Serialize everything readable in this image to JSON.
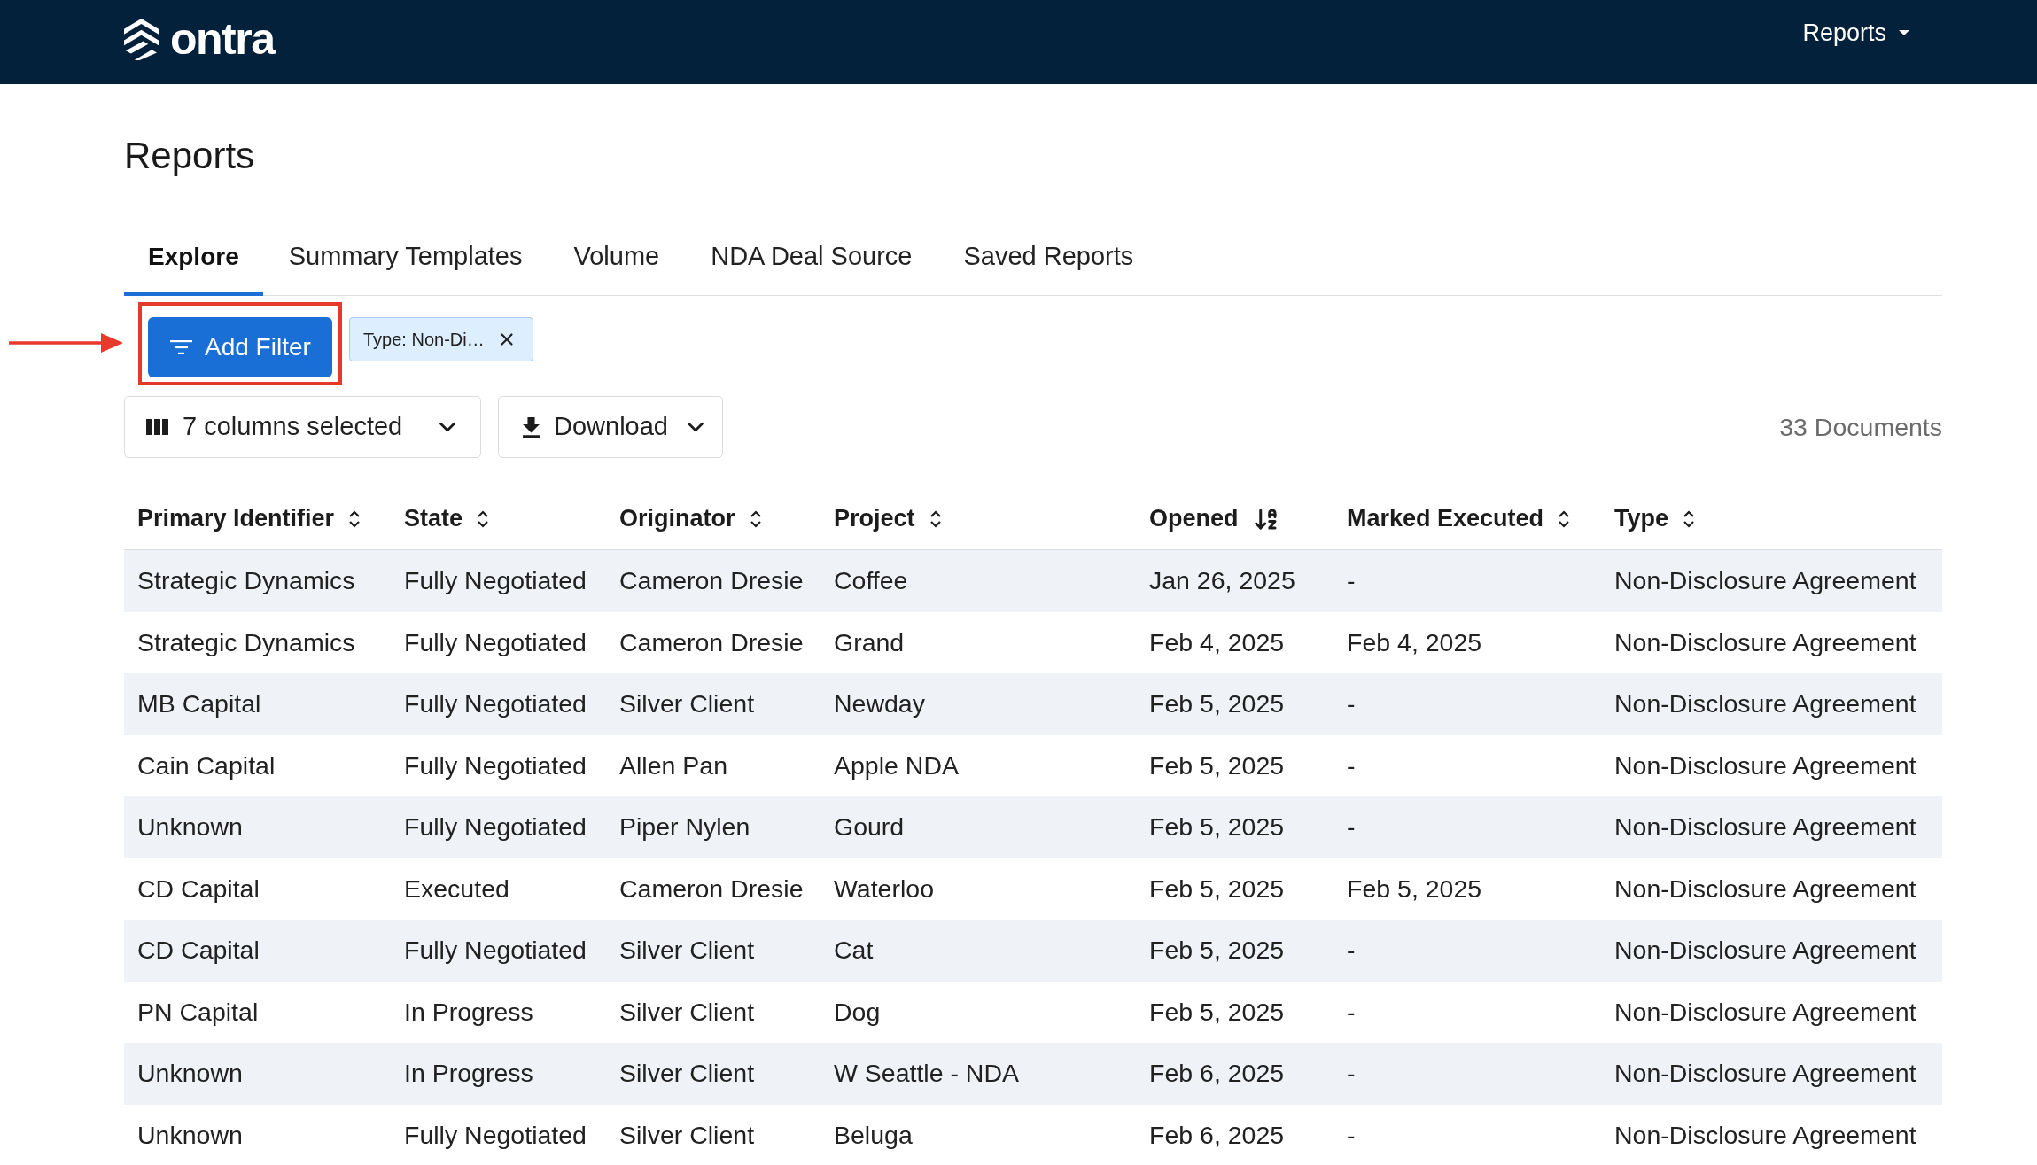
{
  "header": {
    "logo_text": "ontra",
    "menu": {
      "label": "Reports"
    }
  },
  "page_title": "Reports",
  "tabs": [
    {
      "label": "Explore",
      "selected": true
    },
    {
      "label": "Summary Templates",
      "selected": false
    },
    {
      "label": "Volume",
      "selected": false
    },
    {
      "label": "NDA Deal Source",
      "selected": false
    },
    {
      "label": "Saved Reports",
      "selected": false
    }
  ],
  "filters": {
    "add_button": {
      "label": "Add Filter",
      "highlighted": true
    },
    "chips": [
      {
        "label": "Type: Non-Di…"
      }
    ]
  },
  "toolbar": {
    "columns_button": "7 columns selected",
    "download_button": "Download",
    "document_count": "33 Documents"
  },
  "table": {
    "columns": [
      {
        "label": "Primary Identifier",
        "sorted": false
      },
      {
        "label": "State",
        "sorted": false
      },
      {
        "label": "Originator",
        "sorted": false
      },
      {
        "label": "Project",
        "sorted": false
      },
      {
        "label": "Opened",
        "sorted": true
      },
      {
        "label": "Marked Executed",
        "sorted": false
      },
      {
        "label": "Type",
        "sorted": false
      }
    ],
    "rows": [
      [
        "Strategic Dynamics",
        "Fully Negotiated",
        "Cameron Dresie",
        "Coffee",
        "Jan 26, 2025",
        "-",
        "Non-Disclosure Agreement"
      ],
      [
        "Strategic Dynamics",
        "Fully Negotiated",
        "Cameron Dresie",
        "Grand",
        "Feb 4, 2025",
        "Feb 4, 2025",
        "Non-Disclosure Agreement"
      ],
      [
        "MB Capital",
        "Fully Negotiated",
        "Silver Client",
        "Newday",
        "Feb 5, 2025",
        "-",
        "Non-Disclosure Agreement"
      ],
      [
        "Cain Capital",
        "Fully Negotiated",
        "Allen Pan",
        "Apple NDA",
        "Feb 5, 2025",
        "-",
        "Non-Disclosure Agreement"
      ],
      [
        "Unknown",
        "Fully Negotiated",
        "Piper Nylen",
        "Gourd",
        "Feb 5, 2025",
        "-",
        "Non-Disclosure Agreement"
      ],
      [
        "CD Capital",
        "Executed",
        "Cameron Dresie",
        "Waterloo",
        "Feb 5, 2025",
        "Feb 5, 2025",
        "Non-Disclosure Agreement"
      ],
      [
        "CD Capital",
        "Fully Negotiated",
        "Silver Client",
        "Cat",
        "Feb 5, 2025",
        "-",
        "Non-Disclosure Agreement"
      ],
      [
        "PN Capital",
        "In Progress",
        "Silver Client",
        "Dog",
        "Feb 5, 2025",
        "-",
        "Non-Disclosure Agreement"
      ],
      [
        "Unknown",
        "In Progress",
        "Silver Client",
        "W Seattle - NDA",
        "Feb 6, 2025",
        "-",
        "Non-Disclosure Agreement"
      ],
      [
        "Unknown",
        "Fully Negotiated",
        "Silver Client",
        "Beluga",
        "Feb 6, 2025",
        "-",
        "Non-Disclosure Agreement"
      ]
    ]
  }
}
